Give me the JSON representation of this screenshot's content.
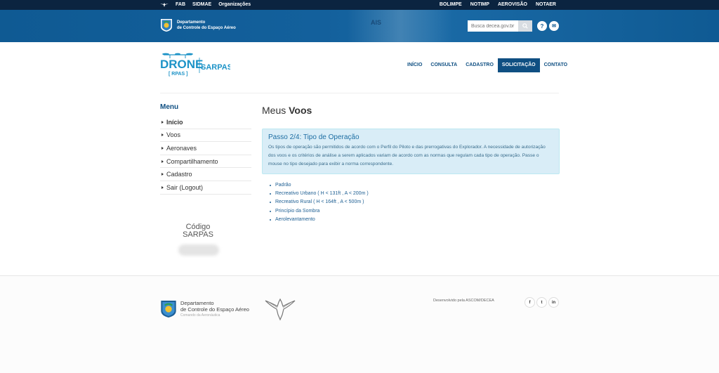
{
  "topbar": {
    "left_links": [
      "FAB",
      "SIDMAE",
      "Organizações"
    ],
    "right_links": [
      "BOLIMPE",
      "NOTIMP",
      "AEROVISÃO",
      "NOTAER"
    ]
  },
  "header": {
    "dept_line1": "Departamento",
    "dept_line2": "de Controle do Espaço Aéreo",
    "watermark_text": "AIS",
    "search_placeholder": "Busca decea.gov.br",
    "help_icon_glyph": "?",
    "chat_icon_glyph": "✉"
  },
  "logo": {
    "drone": "DRONE",
    "rpas": "[ RPAS ]",
    "sarpas": "SARPAS"
  },
  "nav": {
    "items": [
      "INÍCIO",
      "CONSULTA",
      "CADASTRO",
      "SOLICITAÇÃO",
      "CONTATO"
    ],
    "active": "SOLICITAÇÃO"
  },
  "sidebar": {
    "title": "Menu",
    "items": [
      "Início",
      "Voos",
      "Aeronaves",
      "Compartilhamento",
      "Cadastro",
      "Sair (Logout)"
    ],
    "codigo_line1": "Código",
    "codigo_line2": "SARPAS"
  },
  "main": {
    "title_light": "Meus",
    "title_bold": "Voos",
    "info_title": "Passo 2/4: Tipo de Operação",
    "info_text": "Os tipos de operação são permitidos de acordo com o Perfil do Piloto e das prerrogativas do Explorador. A necessidade de autorização dos voos e os critérios de análise a serem aplicados variam de acordo com as normas que regulam cada tipo de operação. Passe o mouse no tipo desejado para exibir a norma correspondente.",
    "operations": [
      "Padrão",
      "Recreativo Urbano ( H < 131ft , A < 200m )",
      "Recreativo Rural ( H < 164ft , A < 500m )",
      "Princípio da Sombra",
      "Aerolevantamento"
    ]
  },
  "footer": {
    "dept_line1": "Departamento",
    "dept_line2": "de Controle do Espaço Aéreo",
    "dept_line3": "Comando da Aeronáutica",
    "developed_by": "Desenvolvido pela ASCOM/DECEA",
    "social": [
      "f",
      "t",
      "in"
    ]
  },
  "colors": {
    "topbar": "#0b2440",
    "header": "#13609c",
    "nav_accent": "#0f4f82",
    "info_bg": "#d9edf7",
    "logo_blue": "#1d93c7"
  },
  "icons": {
    "fab": "wing-emblem-icon",
    "search": "search-icon",
    "help": "help-circle-icon",
    "chat": "chat-bubble-icon",
    "decea": "decea-emblem-icon",
    "fab_eagle": "fab-eagle-icon",
    "facebook": "facebook-icon",
    "twitter": "twitter-icon",
    "linkedin": "linkedin-icon"
  }
}
